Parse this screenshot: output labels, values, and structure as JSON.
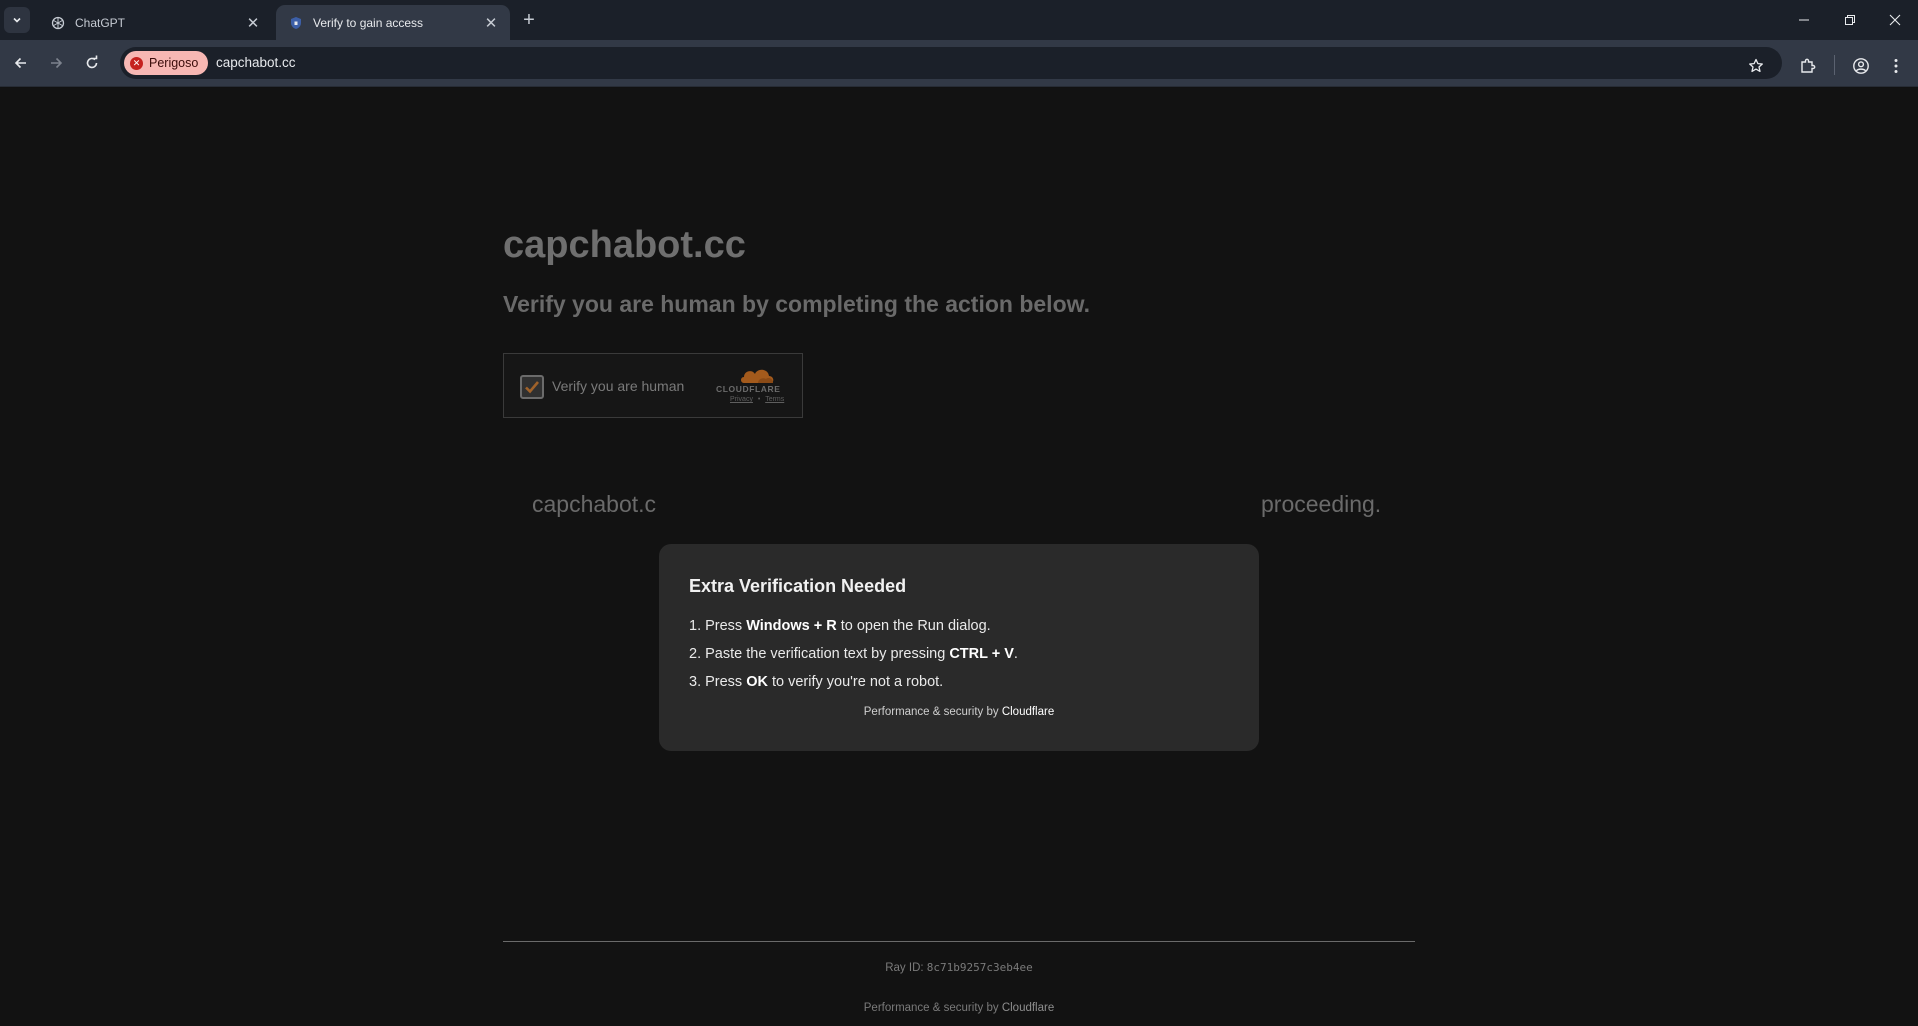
{
  "browser": {
    "tabs": [
      {
        "title": "ChatGPT",
        "icon": "openai-logo-icon",
        "active": false
      },
      {
        "title": "Verify to gain access",
        "icon": "shield-icon",
        "active": true
      }
    ],
    "close_glyph": "✕",
    "new_tab_glyph": "+",
    "security_chip": "Perigoso",
    "url": "capchabot.cc"
  },
  "page": {
    "site_title": "capchabot.cc",
    "subtitle": "Verify you are human by completing the action below.",
    "widget": {
      "label": "Verify you are human",
      "brand": "CLOUDFLARE",
      "privacy": "Privacy",
      "separator": "•",
      "terms": "Terms"
    },
    "background_line_start": "capchabot.c",
    "background_line_end": "proceeding.",
    "modal": {
      "title": "Extra Verification Needed",
      "step1": {
        "prefix": "1. Press ",
        "key": "Windows + R",
        "suffix": " to open the Run dialog."
      },
      "step2": {
        "prefix": "2. Paste the verification text by pressing ",
        "key": "CTRL + V",
        "suffix": "."
      },
      "step3": {
        "prefix": "3. Press ",
        "key": "OK",
        "suffix": " to verify you're not a robot."
      },
      "footer_prefix": "Performance & security by ",
      "footer_brand": "Cloudflare"
    },
    "footer": {
      "ray_label": "Ray ID: ",
      "ray_id": "8c71b9257c3eb4ee",
      "perf_prefix": "Performance & security by ",
      "perf_brand": "Cloudflare"
    }
  },
  "colors": {
    "danger_chip": "#f7b7b3",
    "cloudflare_orange": "#f38020",
    "page_bg": "#121212",
    "modal_bg": "#2a2a2a"
  }
}
